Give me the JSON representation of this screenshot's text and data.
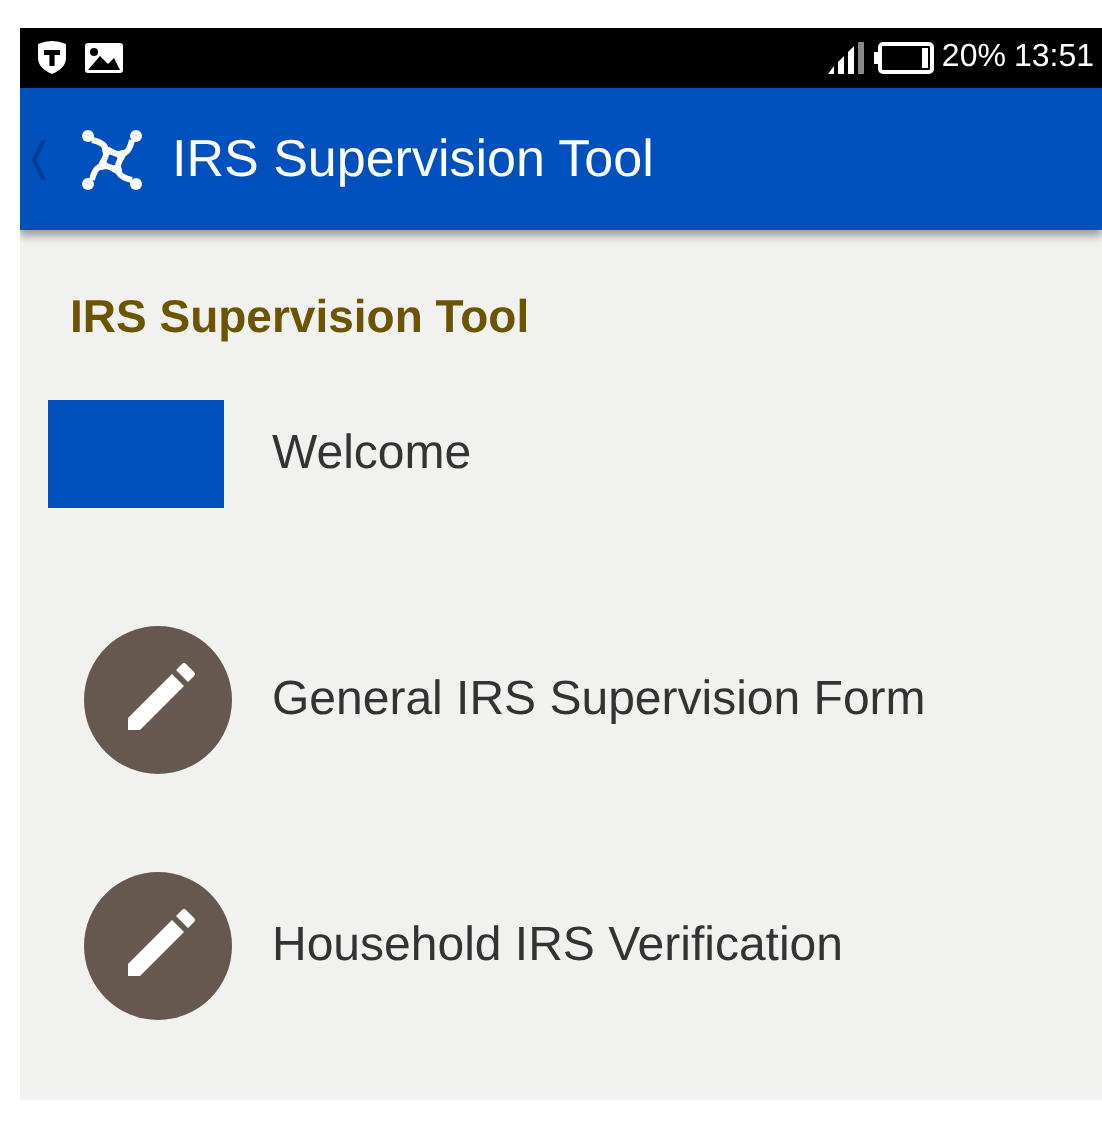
{
  "status_bar": {
    "battery": "20%",
    "time": "13:51"
  },
  "app_bar": {
    "title": "IRS Supervision Tool"
  },
  "heading": "IRS Supervision Tool",
  "items": [
    {
      "kind": "banner",
      "label": "Welcome"
    },
    {
      "kind": "form",
      "label": "General IRS Supervision Form"
    },
    {
      "kind": "form",
      "label": "Household IRS Verification"
    }
  ]
}
